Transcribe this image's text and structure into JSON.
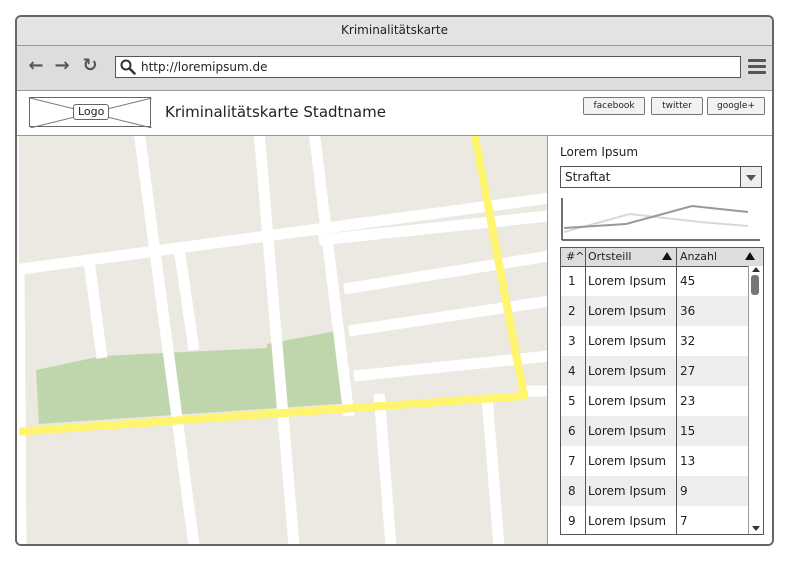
{
  "window": {
    "title": "Kriminalitätskarte"
  },
  "browser": {
    "url": "http://loremipsum.de"
  },
  "header": {
    "logo_label": "Logo",
    "site_title": "Kriminalitätskarte Stadtname",
    "social": [
      "facebook",
      "twitter",
      "google+"
    ]
  },
  "panel": {
    "title": "Lorem Ipsum",
    "select_value": "Straftat",
    "table": {
      "columns": [
        "#^",
        "Ortsteill",
        "Anzahl"
      ],
      "rows": [
        {
          "num": "1",
          "name": "Lorem Ipsum",
          "count": "45"
        },
        {
          "num": "2",
          "name": "Lorem Ipsum",
          "count": "36"
        },
        {
          "num": "3",
          "name": "Lorem Ipsum",
          "count": "32"
        },
        {
          "num": "4",
          "name": "Lorem Ipsum",
          "count": "27"
        },
        {
          "num": "5",
          "name": "Lorem Ipsum",
          "count": "23"
        },
        {
          "num": "6",
          "name": "Lorem Ipsum",
          "count": "15"
        },
        {
          "num": "7",
          "name": "Lorem Ipsum",
          "count": "13"
        },
        {
          "num": "8",
          "name": "Lorem Ipsum",
          "count": "9"
        },
        {
          "num": "9",
          "name": "Lorem Ipsum",
          "count": "7"
        }
      ]
    }
  },
  "icons": {
    "back": "back-arrow-icon",
    "forward": "forward-arrow-icon",
    "reload": "reload-icon",
    "search": "search-icon",
    "menu": "hamburger-menu-icon"
  },
  "colors": {
    "road_highlight": "#fff56e",
    "park": "#bfd6ad",
    "map_bg": "#ece9e2"
  }
}
